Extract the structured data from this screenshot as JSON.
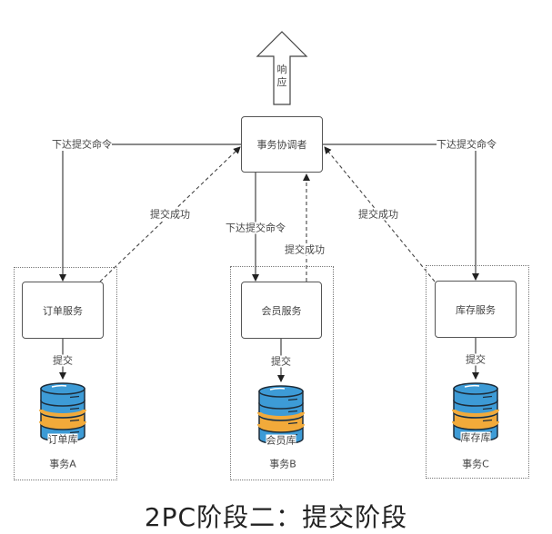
{
  "title": "2PC阶段二：提交阶段",
  "response_label": "响应",
  "coordinator": "事务协调者",
  "labels": {
    "send_commit": "下达提交命令",
    "commit_success": "提交成功",
    "commit": "提交"
  },
  "transactions": [
    {
      "service": "订单服务",
      "db": "订单库",
      "name": "事务A"
    },
    {
      "service": "会员服务",
      "db": "会员库",
      "name": "事务B"
    },
    {
      "service": "库存服务",
      "db": "库存库",
      "name": "事务C"
    }
  ],
  "colors": {
    "db_blue": "#3d9bd6",
    "db_orange": "#f2aa3a",
    "db_outline": "#1e2d3a"
  }
}
